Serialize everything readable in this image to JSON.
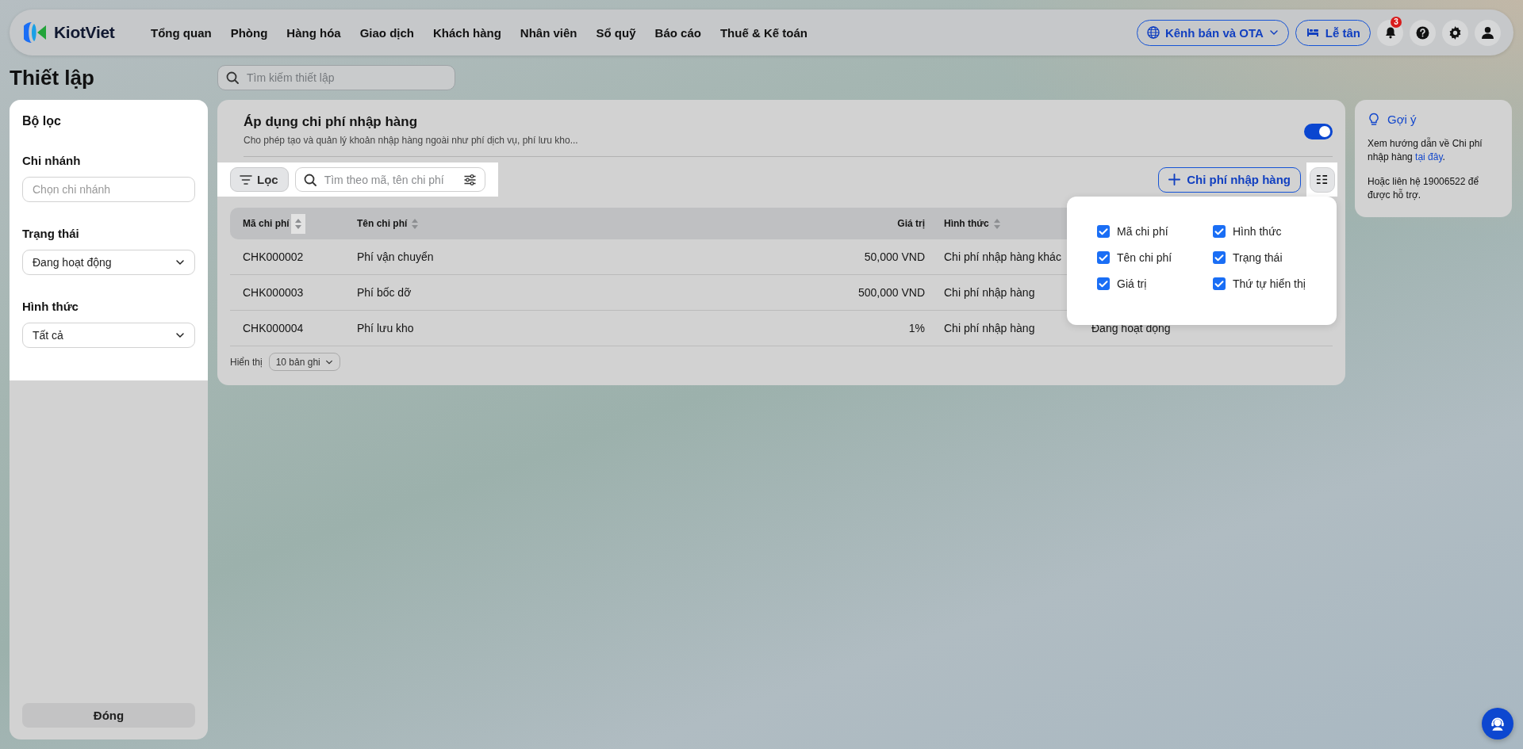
{
  "header": {
    "logo": "KiotViet",
    "nav": [
      {
        "label": "Tổng quan"
      },
      {
        "label": "Phòng"
      },
      {
        "label": "Hàng hóa"
      },
      {
        "label": "Giao dịch"
      },
      {
        "label": "Khách hàng"
      },
      {
        "label": "Nhân viên"
      },
      {
        "label": "Sổ quỹ"
      },
      {
        "label": "Báo cáo"
      },
      {
        "label": "Thuế & Kế toán"
      }
    ],
    "channel_button": "Kênh bán và OTA",
    "reception_button": "Lễ tân",
    "notification_count": "3"
  },
  "page_title": "Thiết lập",
  "settings_search": {
    "placeholder": "Tìm kiếm thiết lập"
  },
  "filter_panel": {
    "title": "Bộ lọc",
    "fields": [
      {
        "label": "Chi nhánh",
        "kind": "input",
        "placeholder": "Chọn chi nhánh"
      },
      {
        "label": "Trạng thái",
        "kind": "select",
        "value": "Đang hoạt động"
      },
      {
        "label": "Hình thức",
        "kind": "select",
        "value": "Tất cả"
      }
    ],
    "close_button": "Đóng"
  },
  "setting": {
    "title": "Áp dụng chi phí nhập hàng",
    "description": "Cho phép tạo và quản lý khoản nhập hàng ngoài như phí dịch vụ, phí lưu kho...",
    "on": true
  },
  "toolbar": {
    "filter_button": "Lọc",
    "search": {
      "placeholder": "Tìm theo mã, tên chi phí"
    },
    "add_button": "Chi phí nhập hàng"
  },
  "table": {
    "columns": [
      {
        "label": "Mã chi phí",
        "kind": "text",
        "sortable": true
      },
      {
        "label": "Tên chi phí",
        "kind": "text",
        "sortable": true
      },
      {
        "label": "Giá trị",
        "kind": "number",
        "sortable": false
      },
      {
        "label": "Hình thức",
        "kind": "text",
        "sortable": true
      }
    ],
    "rows": [
      {
        "cells": [
          "CHK000002",
          "Phí vận chuyển",
          "50,000 VND",
          "Chi phí nhập hàng khác"
        ]
      },
      {
        "cells": [
          "CHK000003",
          "Phí bốc dỡ",
          "500,000 VND",
          "Chi phí nhập hàng"
        ]
      },
      {
        "cells": [
          "CHK000004",
          "Phí lưu kho",
          "1%",
          "Chi phí nhập hàng",
          "Đang hoạt động"
        ]
      }
    ],
    "footer": {
      "label": "Hiển thị",
      "page_size": "10 bản ghi"
    }
  },
  "column_menu": {
    "items": [
      {
        "label": "Mã chi phí",
        "checked": true
      },
      {
        "label": "Hình thức",
        "checked": true
      },
      {
        "label": "Tên chi phí",
        "checked": true
      },
      {
        "label": "Trạng thái",
        "checked": true
      },
      {
        "label": "Giá trị",
        "checked": true
      },
      {
        "label": "Thứ tự hiển thị",
        "checked": true
      }
    ]
  },
  "hint": {
    "title": "Gợi ý",
    "text": "Xem hướng dẫn về Chi phí nhập hàng ",
    "link": "tại đây",
    "text_end": ".",
    "contact": "Hoặc liên hệ 19006522 để được hỗ trợ."
  }
}
